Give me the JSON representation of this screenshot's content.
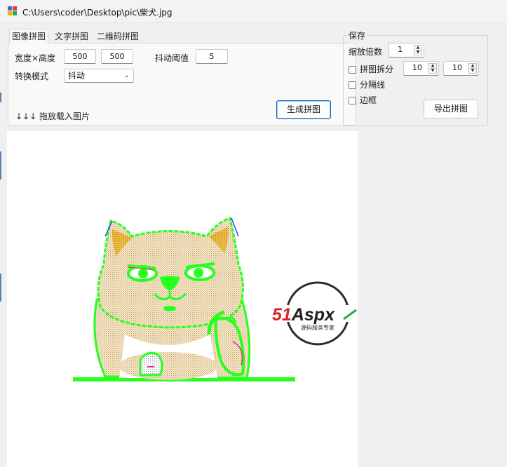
{
  "window": {
    "title": "C:\\Users\\coder\\Desktop\\pic\\柴犬.jpg"
  },
  "tabs": [
    {
      "label": "图像拼图",
      "active": true
    },
    {
      "label": "文字拼图",
      "active": false
    },
    {
      "label": "二维码拼图",
      "active": false
    }
  ],
  "image_tab": {
    "size_label": "宽度×高度",
    "width": "500",
    "height": "500",
    "threshold_label": "抖动阈值",
    "threshold": "5",
    "mode_label": "转换模式",
    "mode_value": "抖动",
    "generate_button": "生成拼图",
    "drop_hint": "↓↓↓ 拖放载入图片"
  },
  "save": {
    "title": "保存",
    "scale_label": "缩放倍数",
    "scale_value": "1",
    "split_label": "拼图拆分",
    "split_cols": "10",
    "split_rows": "10",
    "divider_label": "分隔线",
    "border_label": "边框",
    "export_button": "导出拼图"
  },
  "watermark": {
    "brand": "51Aspx",
    "brand_red": "51",
    "brand_dark": "Aspx",
    "tagline": "源码服务专家"
  },
  "colors": {
    "accent": "#0f6cbd",
    "dither_green": "#27ff1f",
    "watermark_red": "#e0202a"
  }
}
